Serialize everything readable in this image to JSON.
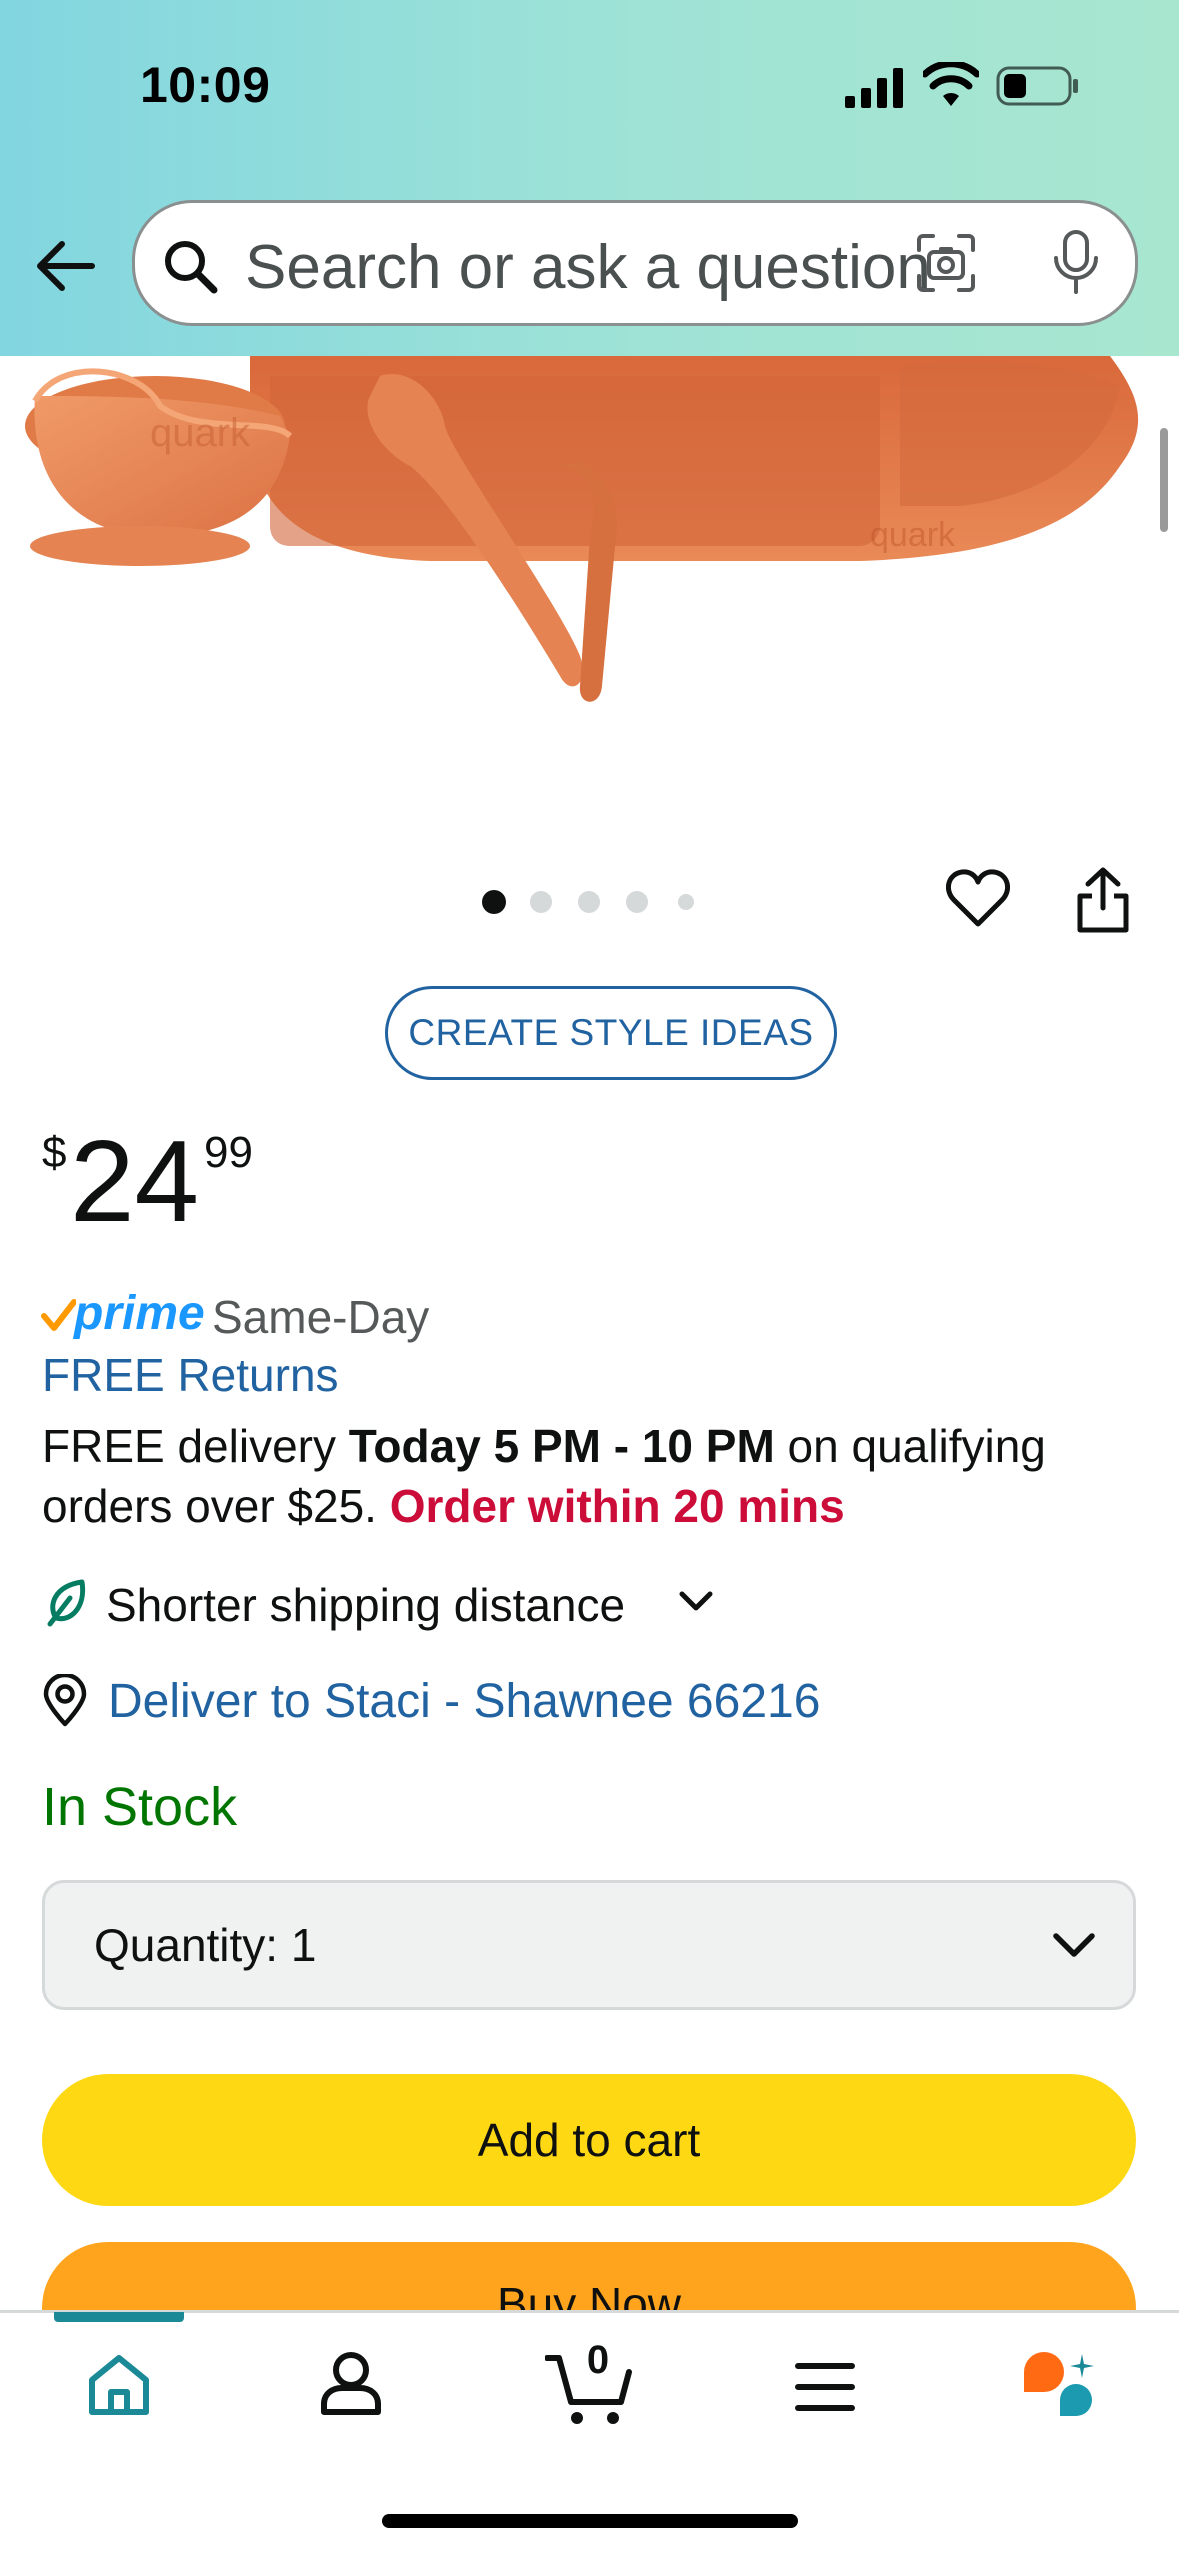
{
  "status_bar": {
    "time": "10:09"
  },
  "search": {
    "placeholder": "Search or ask a question"
  },
  "product": {
    "image_brand_marks": [
      "quark",
      "quark"
    ],
    "carousel": {
      "count": 5,
      "active_index": 0
    },
    "style_ideas_label": "CREATE STYLE IDEAS",
    "price": {
      "symbol": "$",
      "whole": "24",
      "fraction": "99"
    },
    "prime": {
      "word": "prime",
      "label": "Same-Day"
    },
    "free_returns": "FREE Returns",
    "delivery": {
      "prefix": "FREE delivery ",
      "window": "Today 5 PM - 10 PM",
      "mid": " on qualifying orders over $25. ",
      "cutoff": "Order within 20 mins"
    },
    "shipping_distance": "Shorter shipping distance",
    "deliver_to": "Deliver to Staci - Shawnee 66216",
    "stock": "In Stock",
    "quantity_label": "Quantity:",
    "quantity_value": "1",
    "add_to_cart": "Add to cart",
    "buy_now": "Buy Now"
  },
  "bottom_nav": {
    "items": [
      "home",
      "account",
      "cart",
      "menu",
      "rufus"
    ],
    "cart_count": "0"
  },
  "colors": {
    "header_gradient_start": "#82d6e0",
    "header_gradient_end": "#a8e6cf",
    "link_blue": "#2162a1",
    "prime_blue": "#1a98ff",
    "in_stock_green": "#007600",
    "urgent_red": "#cc0c39",
    "add_to_cart_yellow": "#ffd814",
    "buy_now_orange": "#ffa41c",
    "product_orange": "#e07a47",
    "home_accent": "#1b8a96"
  }
}
